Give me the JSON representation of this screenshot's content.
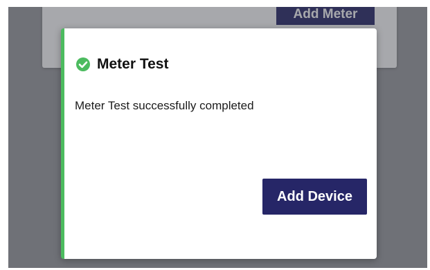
{
  "background": {
    "button_label": "Add Meter"
  },
  "modal": {
    "title": "Meter Test",
    "status_icon": "check-circle-icon",
    "message": "Meter Test successfully completed",
    "primary_button_label": "Add Device",
    "accent_color": "#4cbb5f",
    "button_color": "#262667"
  }
}
